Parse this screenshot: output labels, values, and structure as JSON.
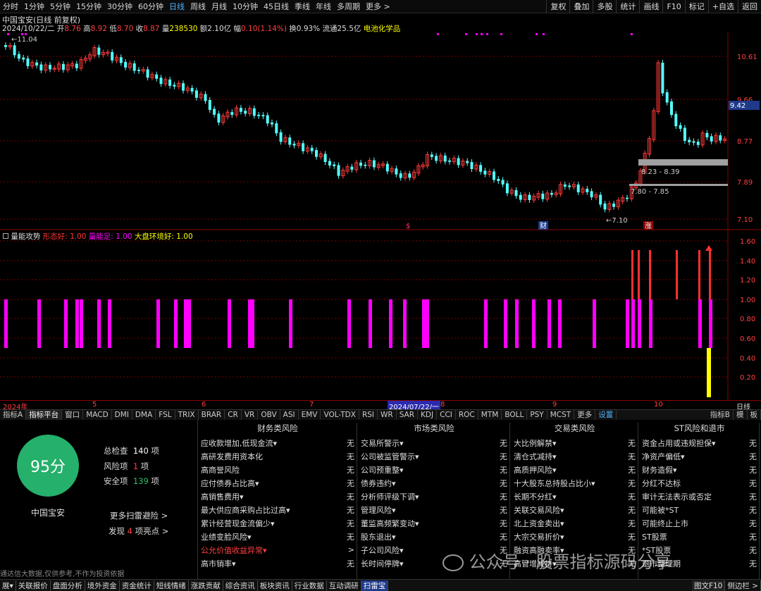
{
  "toolbar": {
    "periods": [
      "分时",
      "1分钟",
      "5分钟",
      "15分钟",
      "30分钟",
      "60分钟",
      "日线",
      "周线",
      "月线",
      "10分钟",
      "45日线",
      "季线",
      "年线",
      "多周期",
      "更多 >"
    ],
    "active": "日线",
    "right_buttons": [
      "复权",
      "叠加",
      "多股",
      "统计",
      "画线",
      "F10",
      "标记",
      "+自选",
      "返回"
    ]
  },
  "quote": {
    "title": "中国宝安(日线 前复权)",
    "date": "2024/10/22/二",
    "open_label": "开",
    "open": "8.76",
    "high_label": "高",
    "high": "8.92",
    "low_label": "低",
    "low": "8.70",
    "close_label": "收",
    "close": "8.87",
    "vol_label": "量",
    "vol": "238530",
    "amt_label": "额",
    "amt": "2.10亿",
    "chg_label": "幅",
    "chg": "0.10(1.14%)",
    "turn": "换0.93%",
    "float": "流通25.5亿",
    "sector": "电池化学品"
  },
  "price_axis": [
    "10.61",
    "9.66",
    "8.77",
    "7.89",
    "7.10"
  ],
  "current_price": "9.42",
  "annotations": {
    "high": "11.04",
    "low": "7.10",
    "range1": "8.23 - 8.39",
    "range2": "7.80 - 7.85",
    "markers": [
      "$",
      "财",
      "涨"
    ]
  },
  "indicator": {
    "name": "量能攻势",
    "l1": "形态好: 1.00",
    "l2": "量能足: 1.00",
    "l3": "大盘环境好: 1.00",
    "axis": [
      "1.60",
      "1.40",
      "1.20",
      "1.00",
      "0.80",
      "0.60",
      "0.40",
      "0.20"
    ],
    "colors": {
      "l1": "#ff3030",
      "l2": "#ff00ff",
      "l3": "#ffff00"
    }
  },
  "dates": {
    "labels": [
      "2024年",
      "5",
      "6",
      "7",
      "8",
      "9",
      "10"
    ],
    "highlight": "2024/07/22/一",
    "right": "日线"
  },
  "tabs": [
    "指标A",
    "指标平台",
    "窗口",
    "MACD",
    "DMI",
    "DMA",
    "FSL",
    "TRIX",
    "BRAR",
    "CR",
    "VR",
    "OBV",
    "ASI",
    "EMV",
    "VOL-TDX",
    "RSI",
    "WR",
    "SAR",
    "KDJ",
    "CCI",
    "ROC",
    "MTM",
    "BOLL",
    "PSY",
    "MCST",
    "更多",
    "设置"
  ],
  "tabs_right": [
    "指标B",
    "模",
    "板"
  ],
  "scan": {
    "score": "95分",
    "stock": "中国宝安",
    "total_label": "总检查",
    "total": "140",
    "total_unit": "项",
    "risk_label": "风险项",
    "risk": "1",
    "risk_unit": "项",
    "safe_label": "安全项",
    "safe": "139",
    "safe_unit": "项",
    "more": "更多扫雷避险 >",
    "found_pre": "发现",
    "found": "4",
    "found_post": "项亮点 >"
  },
  "columns": [
    {
      "title": "财务类风险",
      "items": [
        [
          "应收款增加,低现金流▾",
          "无"
        ],
        [
          "高研发费用资本化",
          "无"
        ],
        [
          "高商誉风险",
          "无"
        ],
        [
          "应付债券占比高▾",
          "无"
        ],
        [
          "高销售费用▾",
          "无"
        ],
        [
          "最大供应商采购占比过高▾",
          "无"
        ],
        [
          "累计经营现金流偏少▾",
          "无"
        ],
        [
          "业绩变脸风险▾",
          "无"
        ],
        [
          "公允价值收益异常▾",
          ">"
        ],
        [
          "高市销率▾",
          "无"
        ]
      ]
    },
    {
      "title": "市场类风险",
      "items": [
        [
          "交易所警示▾",
          "无"
        ],
        [
          "公司被监管警示▾",
          "无"
        ],
        [
          "公司预重整▾",
          "无"
        ],
        [
          "债券违约▾",
          "无"
        ],
        [
          "分析师评级下调▾",
          "无"
        ],
        [
          "管理风险▾",
          "无"
        ],
        [
          "董监高频繁变动▾",
          "无"
        ],
        [
          "股东退出▾",
          "无"
        ],
        [
          "子公司风险▾",
          "无"
        ],
        [
          "长时间停牌▾",
          "无"
        ]
      ]
    },
    {
      "title": "交易类风险",
      "items": [
        [
          "大比例解禁▾",
          "无"
        ],
        [
          "清仓式减持▾",
          "无"
        ],
        [
          "高质押风险▾",
          "无"
        ],
        [
          "十大股东总持股占比小▾",
          "无"
        ],
        [
          "长期不分红▾",
          "无"
        ],
        [
          "关联交易风险▾",
          "无"
        ],
        [
          "北上资金卖出▾",
          "无"
        ],
        [
          "大宗交易折价▾",
          "无"
        ],
        [
          "融资高融卖率▾",
          "无"
        ],
        [
          "高管增减持▾",
          "无"
        ]
      ]
    },
    {
      "title": "ST风险和退市",
      "items": [
        [
          "资金占用或违规担保▾",
          "无"
        ],
        [
          "净资产偏低▾",
          "无"
        ],
        [
          "财务造假▾",
          "无"
        ],
        [
          "分红不达标",
          "无"
        ],
        [
          "审计无法表示或否定",
          "无"
        ],
        [
          "可能被*ST",
          "无"
        ],
        [
          "可能终止上市",
          "无"
        ],
        [
          "ST股票",
          "无"
        ],
        [
          "*ST股票",
          "无"
        ],
        [
          "退市整理期",
          "无"
        ]
      ]
    }
  ],
  "footnote": "通达信大数据,仅供参考,不作为投资依据",
  "watermark": "公众号 · 股票指标源码分享",
  "status": [
    "展▾",
    "关联报价",
    "盘面分析",
    "境外资金",
    "资金统计",
    "短线情绪",
    "涨跌贡献",
    "综合资讯",
    "板块资讯",
    "行业数据",
    "互动调研",
    "扫雷宝"
  ],
  "status_right": "图文F10",
  "status_right2": "侧边栏 >"
}
